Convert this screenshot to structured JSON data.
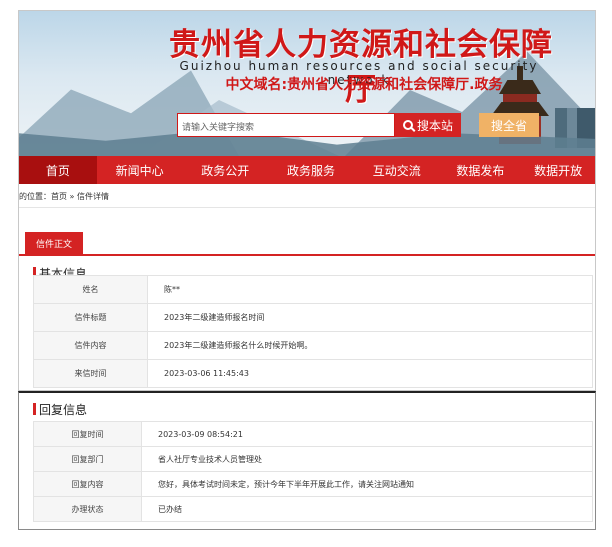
{
  "header": {
    "title": "贵州省人力资源和社会保障厅",
    "subtitle": "Guizhou human resources and social security network",
    "domain_name": "中文域名:贵州省人力资源和社会保障厅.政务",
    "search_placeholder": "请输入关键字搜索",
    "search_button": "搜本站",
    "province_button": "搜全省"
  },
  "nav": {
    "items": [
      "首页",
      "新闻中心",
      "政务公开",
      "政务服务",
      "互动交流",
      "数据发布",
      "数据开放"
    ]
  },
  "breadcrumb": "的位置：首页 » 信件详情",
  "tab": {
    "label": "信件正文"
  },
  "basic_info": {
    "title": "基本信息",
    "rows": [
      {
        "label": "姓名",
        "value": "陈**"
      },
      {
        "label": "信件标题",
        "value": "2023年二级建造师报名时间"
      },
      {
        "label": "信件内容",
        "value": "2023年二级建造师报名什么时候开始啊。"
      },
      {
        "label": "来信时间",
        "value": "2023-03-06 11:45:43"
      }
    ]
  },
  "reply_info": {
    "title": "回复信息",
    "rows": [
      {
        "label": "回复时间",
        "value": "2023-03-09 08:54:21"
      },
      {
        "label": "回复部门",
        "value": "省人社厅专业技术人员管理处"
      },
      {
        "label": "回复内容",
        "value": "您好，具体考试时间未定，预计今年下半年开展此工作，请关注网站通知"
      },
      {
        "label": "办理状态",
        "value": "已办结"
      }
    ]
  },
  "colors": {
    "accent": "#d42323",
    "nav_active": "#a80f0f",
    "province_button": "#f0b266"
  }
}
